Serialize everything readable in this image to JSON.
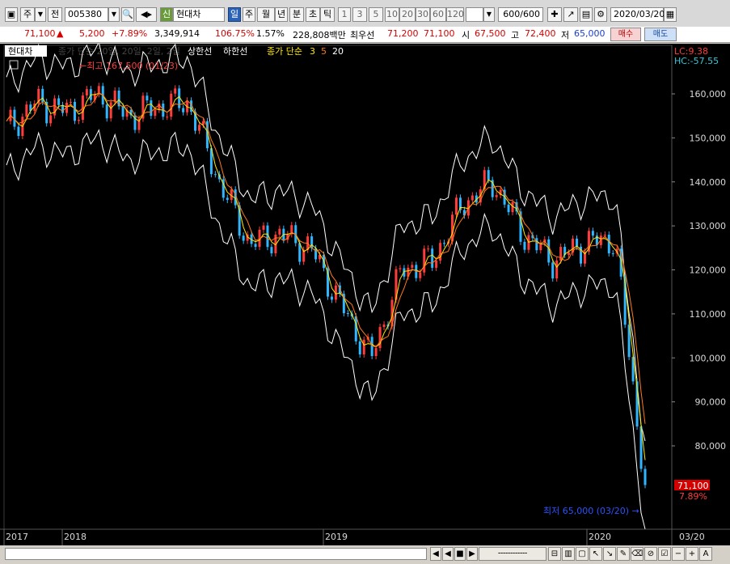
{
  "toolbar": {
    "period_type": "주",
    "prefix": "전",
    "code": "005380",
    "badge": "신",
    "name": "현대차",
    "periods": [
      "일",
      "주",
      "월",
      "년",
      "분",
      "초",
      "틱"
    ],
    "ticks": [
      "1",
      "3",
      "5",
      "10",
      "20",
      "30",
      "60",
      "120"
    ],
    "count": "600",
    "count_total": "/600",
    "date": "2020/03/20",
    "selected_period": "일"
  },
  "quote": {
    "price": "71,100",
    "change_arrow": "▲",
    "change": "5,200",
    "change_pct": "+7.89%",
    "volume": "3,349,914",
    "vol_ratio": "106.75%",
    "turnover": "1.57%",
    "amount": "228,808백만",
    "best_label": "최우선",
    "best_ask": "71,200",
    "best_bid": "71,100",
    "open_label": "시",
    "open": "67,500",
    "high_label": "고",
    "high": "72,400",
    "low_label": "저",
    "low": "65,000",
    "buy": "매수",
    "sell": "매도"
  },
  "legend": {
    "name": "현대차",
    "envelope": "종가 단순 20일, 20일, 2일, 2일",
    "upper": "상한선",
    "lower": "하한선",
    "ma": "종가 단순",
    "ma_periods": [
      "3",
      "5",
      "20"
    ]
  },
  "indicators": {
    "lc": "LC:9.38",
    "hc": "HC:-57.55"
  },
  "annotations": {
    "max": "←최고 167,500 (01/23)",
    "min": "최저 65,000 (03/20) →"
  },
  "axis": {
    "y_ticks": [
      "160,000",
      "150,000",
      "140,000",
      "130,000",
      "120,000",
      "110,000",
      "100,000",
      "90,000",
      "80,000"
    ],
    "x_labels": [
      "2017",
      "2018",
      "2019",
      "2020"
    ],
    "x_last": "03/20",
    "current_price": "71,100",
    "current_pct": "7.89%"
  },
  "colors": {
    "background": "#000000",
    "up": "#ff3c3c",
    "down": "#2fb6ff",
    "ma3": "#ffe800",
    "ma5": "#ff7a1a",
    "band": "#ffffff",
    "price_tag": "#d40000",
    "selected": "#2a62b8"
  },
  "chart_data": {
    "type": "line",
    "title": "현대차",
    "x": [
      "2017-01",
      "2017-03",
      "2017-05",
      "2017-07",
      "2017-09",
      "2017-11",
      "2018-01",
      "2018-02",
      "2018-04",
      "2018-06",
      "2018-08",
      "2018-10",
      "2018-12",
      "2019-02",
      "2019-04",
      "2019-06",
      "2019-08",
      "2019-10",
      "2019-12",
      "2020-01",
      "2020-02",
      "2020-03-20"
    ],
    "series": [
      {
        "name": "종가",
        "values": [
          152000,
          158000,
          156000,
          160000,
          155000,
          157000,
          158000,
          140000,
          126000,
          128000,
          125000,
          112000,
          100000,
          120000,
          122000,
          135000,
          140000,
          128000,
          122000,
          126000,
          127000,
          71100
        ]
      }
    ],
    "ylim": [
      70000,
      168000
    ],
    "y_ticks": [
      80000,
      90000,
      100000,
      110000,
      120000,
      130000,
      140000,
      150000,
      160000
    ],
    "max_point": {
      "value": 167500,
      "date": "01/23"
    },
    "min_point": {
      "value": 65000,
      "date": "03/20"
    }
  }
}
